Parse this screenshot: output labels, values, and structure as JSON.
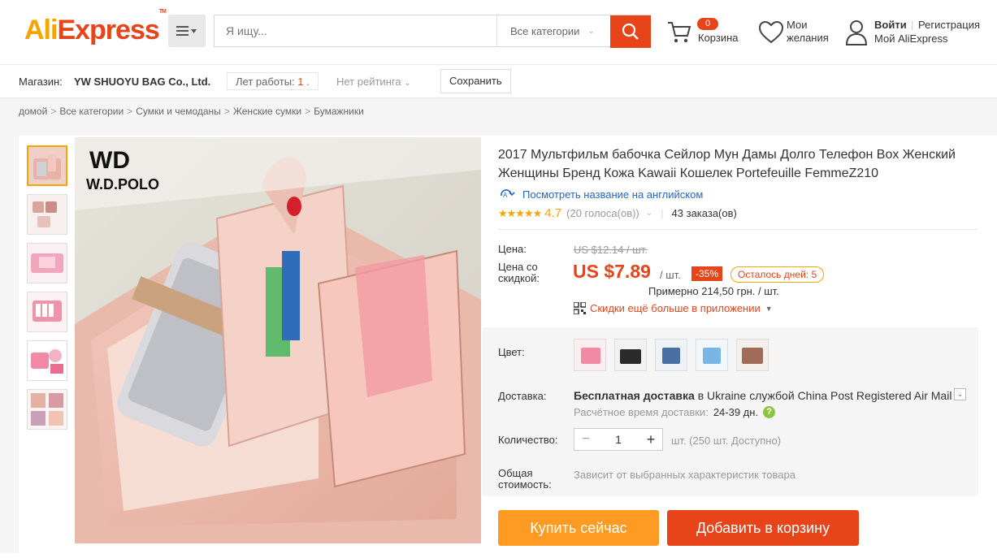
{
  "header": {
    "logo_part1": "Ali",
    "logo_part2": "Express",
    "logo_tm": "TM",
    "search_placeholder": "Я ищу...",
    "category_select": "Все категории",
    "cart_count": "0",
    "cart_label": "Корзина",
    "wishlist_label": "Мои желания",
    "login": "Войти",
    "register": "Регистрация",
    "my_account": "Мой AliExpress"
  },
  "store": {
    "label": "Магазин:",
    "name": "YW SHUOYU BAG Co., Ltd.",
    "years_label": "Лет работы:",
    "years_value": "1",
    "rating": "Нет рейтинга",
    "save": "Сохранить"
  },
  "breadcrumb": [
    "домой",
    "Все категории",
    "Сумки и чемоданы",
    "Женские сумки",
    "Бумажники"
  ],
  "product": {
    "image_brand": "W.D.POLO",
    "title": "2017 Мультфильм бабочка Сейлор Мун Дамы Долго Телефон Box Женский Женщины Бренд Кожа Kawaii Кошелек Portefeuille FemmeZ210",
    "translate_link": "Посмотреть название на английском",
    "rating": "4.7",
    "votes": "(20 голоса(ов))",
    "orders": "43 заказа(ов)",
    "price_label": "Цена:",
    "old_price": "US $12.14 / шт.",
    "discount_label": "Цена со скидкой:",
    "price": "US $7.89",
    "per_unit": "/ шт.",
    "discount": "-35%",
    "days_left": "Осталось дней: 5",
    "approx": "Примерно 214,50 грн. / шт.",
    "app_promo": "Скидки ещё больше в приложении",
    "color_label": "Цвет:",
    "colors": [
      "pink",
      "black",
      "blue",
      "sky-blue",
      "brown"
    ],
    "shipping_label": "Доставка:",
    "shipping_free": "Бесплатная доставка",
    "shipping_in": "в",
    "shipping_country": "Ukraine",
    "shipping_service_pre": "службой",
    "shipping_service": "China Post Registered Air Mail",
    "ship_time_label": "Расчётное время доставки:",
    "ship_time": "24-39 дн.",
    "quantity_label": "Количество:",
    "quantity": "1",
    "available": "шт. (250 шт. Доступно)",
    "total_label": "Общая стоимость:",
    "total_note": "Зависит от выбранных характеристик товара",
    "buy_now": "Купить сейчас",
    "add_to_cart": "Добавить в корзину"
  }
}
